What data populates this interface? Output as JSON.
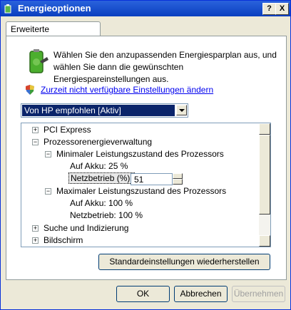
{
  "window": {
    "title": "Energieoptionen",
    "help_label": "?",
    "close_label": "X"
  },
  "tab": {
    "label": "Erweiterte Einstellungen"
  },
  "intro_text": "Wählen Sie den anzupassenden Energiesparplan aus, und wählen Sie dann die gewünschten Energiespareinstellungen aus.",
  "link_text": "Zurzeit nicht verfügbare Einstellungen ändern",
  "plan_select": {
    "value": "Von HP empfohlen [Aktiv]"
  },
  "tree": {
    "items": [
      {
        "label": "PCI Express",
        "expander": "+"
      },
      {
        "label": "Prozessorenergieverwaltung",
        "expander": "−"
      },
      {
        "label": "Minimaler Leistungszustand des Prozessors",
        "expander": "−"
      },
      {
        "label": "Auf Akku:",
        "value": "25 %"
      },
      {
        "label": "Netzbetrieb (%):",
        "value": "51"
      },
      {
        "label": "Maximaler Leistungszustand des Prozessors",
        "expander": "−"
      },
      {
        "label": "Auf Akku:",
        "value": "100 %"
      },
      {
        "label": "Netzbetrieb:",
        "value": "100 %"
      },
      {
        "label": "Suche und Indizierung",
        "expander": "+"
      },
      {
        "label": "Bildschirm",
        "expander": "+"
      }
    ]
  },
  "restore_button": "Standardeinstellungen wiederherstellen",
  "footer": {
    "ok": "OK",
    "cancel": "Abbrechen",
    "apply": "Übernehmen"
  }
}
